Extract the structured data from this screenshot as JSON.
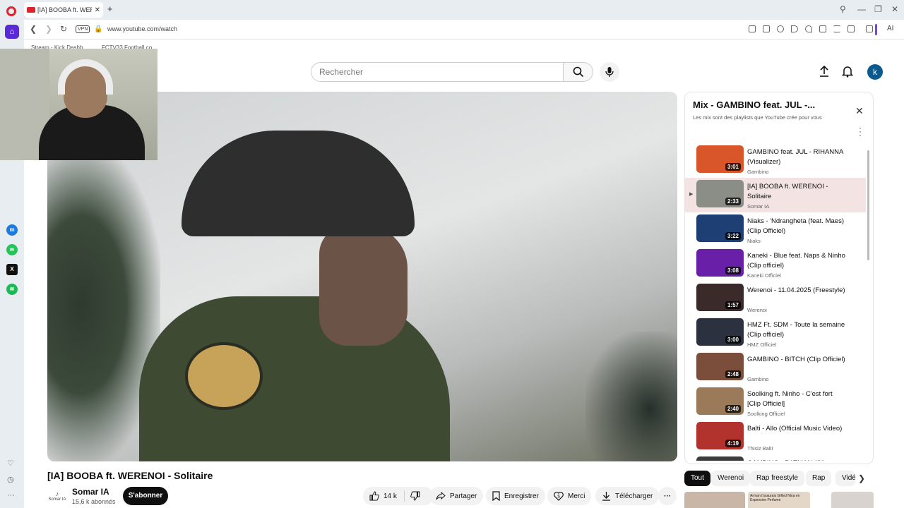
{
  "browser": {
    "tab_title": "[IA] BOOBA ft. WERENOI",
    "url": "www.youtube.com/watch",
    "vpn": "VPN",
    "ai_label": "AI",
    "bookmarks": [
      "Stream - Kick Dashb...",
      "FCTV33 Football co..."
    ]
  },
  "search": {
    "placeholder": "Rechercher"
  },
  "user": {
    "avatar_letter": "k"
  },
  "video": {
    "title": "[IA] BOOBA ft. WERENOI - Solitaire",
    "channel": "Somar IA",
    "channel_logo_text": "Somar IA",
    "subscribers": "15,6 k abonnés",
    "subscribe_label": "S'abonner",
    "likes": "14 k",
    "share_label": "Partager",
    "save_label": "Enregistrer",
    "thanks_label": "Merci",
    "download_label": "Télécharger"
  },
  "playlist": {
    "title": "Mix - GAMBINO feat. JUL -...",
    "subtitle": "Les mix sont des playlists que YouTube crée pour vous",
    "items": [
      {
        "title": "GAMBINO feat. JUL - RIHANNA (Visualizer)",
        "channel": "Gambino",
        "duration": "3:01",
        "color": "#d9562a",
        "active": false
      },
      {
        "title": "[IA] BOOBA ft. WERENOI - Solitaire",
        "channel": "Somar IA",
        "duration": "2:33",
        "color": "#8b8e86",
        "active": true
      },
      {
        "title": "Niaks - 'Ndrangheta (feat. Maes) (Clip Officiel)",
        "channel": "Niaks",
        "duration": "3:22",
        "color": "#1d3f74",
        "active": false
      },
      {
        "title": "Kaneki - Blue feat. Naps & Ninho (Clip officiel)",
        "channel": "Kaneki Officiel",
        "duration": "3:08",
        "color": "#6a1fa8",
        "active": false
      },
      {
        "title": "Werenoi - 11.04.2025 (Freestyle)",
        "channel": "Werenoi",
        "duration": "1:57",
        "color": "#3a2a2a",
        "active": false
      },
      {
        "title": "HMZ Ft. SDM - Toute la semaine (Clip officiel)",
        "channel": "HMZ Officiel",
        "duration": "3:00",
        "color": "#2c3140",
        "active": false
      },
      {
        "title": "GAMBINO - BITCH (Clip Officiel)",
        "channel": "Gambino",
        "duration": "2:48",
        "color": "#7a4e3a",
        "active": false
      },
      {
        "title": "Soolking ft. Ninho - C'est fort [Clip Officiel]",
        "channel": "Soolking Officiel",
        "duration": "2:40",
        "color": "#9a7a58",
        "active": false
      },
      {
        "title": "Balti - Allo (Official Music Video)",
        "channel": "Thisiz Balti",
        "duration": "4:19",
        "color": "#b2332d",
        "active": false
      },
      {
        "title": "GAMBINO - BATMAN (Clip",
        "channel": "",
        "duration": "",
        "color": "#3c3c3c",
        "active": false
      }
    ]
  },
  "chips": [
    "Tout",
    "Werenoi",
    "Rap freestyle",
    "Rap",
    "Vidé"
  ],
  "recommendations_thumb_text": "Arman t'ssaurais Gifted Nina en Expensive Perfume"
}
